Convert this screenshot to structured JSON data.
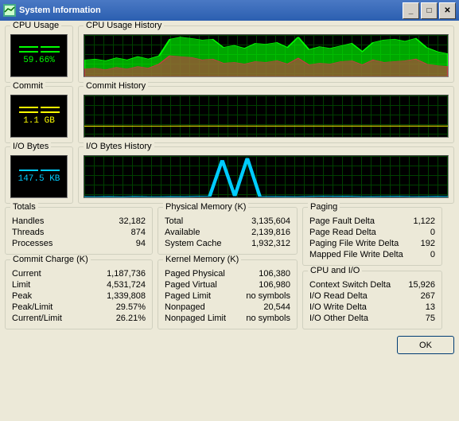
{
  "window": {
    "title": "System Information"
  },
  "gauges": {
    "cpu": {
      "title": "CPU Usage",
      "value": "59.66%",
      "color": "#00ff00"
    },
    "commit": {
      "title": "Commit",
      "value": "1.1 GB",
      "color": "#ffff00"
    },
    "io": {
      "title": "I/O Bytes",
      "value": "147.5 KB",
      "color": "#00ccff"
    }
  },
  "histories": {
    "cpu": "CPU Usage History",
    "commit": "Commit History",
    "io": "I/O Bytes History"
  },
  "totals": {
    "title": "Totals",
    "rows": [
      {
        "label": "Handles",
        "value": "32,182"
      },
      {
        "label": "Threads",
        "value": "874"
      },
      {
        "label": "Processes",
        "value": "94"
      }
    ]
  },
  "commit_charge": {
    "title": "Commit Charge (K)",
    "rows": [
      {
        "label": "Current",
        "value": "1,187,736"
      },
      {
        "label": "Limit",
        "value": "4,531,724"
      },
      {
        "label": "Peak",
        "value": "1,339,808"
      },
      {
        "label": "Peak/Limit",
        "value": "29.57%"
      },
      {
        "label": "Current/Limit",
        "value": "26.21%"
      }
    ]
  },
  "physmem": {
    "title": "Physical Memory (K)",
    "rows": [
      {
        "label": "Total",
        "value": "3,135,604"
      },
      {
        "label": "Available",
        "value": "2,139,816"
      },
      {
        "label": "System Cache",
        "value": "1,932,312"
      }
    ]
  },
  "kernel": {
    "title": "Kernel Memory (K)",
    "rows": [
      {
        "label": "Paged Physical",
        "value": "106,380"
      },
      {
        "label": "Paged Virtual",
        "value": "106,980"
      },
      {
        "label": "Paged Limit",
        "value": "no symbols"
      },
      {
        "label": "Nonpaged",
        "value": "20,544"
      },
      {
        "label": "Nonpaged Limit",
        "value": "no symbols"
      }
    ]
  },
  "paging": {
    "title": "Paging",
    "rows": [
      {
        "label": "Page Fault Delta",
        "value": "1,122"
      },
      {
        "label": "Page Read Delta",
        "value": "0"
      },
      {
        "label": "Paging File Write Delta",
        "value": "192"
      },
      {
        "label": "Mapped File Write Delta",
        "value": "0"
      }
    ]
  },
  "cpuio": {
    "title": "CPU and I/O",
    "rows": [
      {
        "label": "Context Switch Delta",
        "value": "15,926"
      },
      {
        "label": "I/O Read Delta",
        "value": "267"
      },
      {
        "label": "I/O Write Delta",
        "value": "13"
      },
      {
        "label": "I/O Other Delta",
        "value": "75"
      }
    ]
  },
  "buttons": {
    "ok": "OK"
  },
  "chart_data": [
    {
      "type": "line",
      "title": "CPU Usage History",
      "ylim": [
        0,
        100
      ],
      "series": [
        {
          "name": "total",
          "color": "#00ff00",
          "values": [
            40,
            42,
            38,
            45,
            40,
            48,
            42,
            50,
            90,
            95,
            92,
            88,
            90,
            70,
            75,
            68,
            80,
            78,
            82,
            70,
            95,
            65,
            72,
            68,
            74,
            80,
            60,
            82,
            88,
            90,
            85,
            92,
            70,
            60,
            55
          ]
        },
        {
          "name": "kernel",
          "color": "#c04040",
          "values": [
            18,
            20,
            16,
            22,
            18,
            24,
            20,
            30,
            50,
            48,
            46,
            40,
            42,
            32,
            34,
            30,
            36,
            34,
            38,
            30,
            44,
            28,
            32,
            30,
            36,
            38,
            28,
            40,
            34,
            36,
            38,
            42,
            30,
            26,
            24
          ]
        }
      ]
    },
    {
      "type": "line",
      "title": "Commit History",
      "ylim": [
        0,
        4531724
      ],
      "series": [
        {
          "name": "commit",
          "color": "#ffff00",
          "values": [
            1180000,
            1180000,
            1182000,
            1183000,
            1184000,
            1185000,
            1185000,
            1186000,
            1186000,
            1187000,
            1187000,
            1187000,
            1187500,
            1187700,
            1187736
          ]
        }
      ]
    },
    {
      "type": "line",
      "title": "I/O Bytes History",
      "ylim": [
        0,
        1000
      ],
      "series": [
        {
          "name": "io",
          "color": "#00ccff",
          "values": [
            20,
            18,
            22,
            16,
            24,
            20,
            18,
            22,
            20,
            26,
            28,
            900,
            30,
            950,
            24,
            22,
            20,
            18,
            24,
            30,
            26,
            28,
            22,
            20,
            24,
            26,
            22,
            20,
            24,
            22
          ]
        }
      ]
    }
  ]
}
